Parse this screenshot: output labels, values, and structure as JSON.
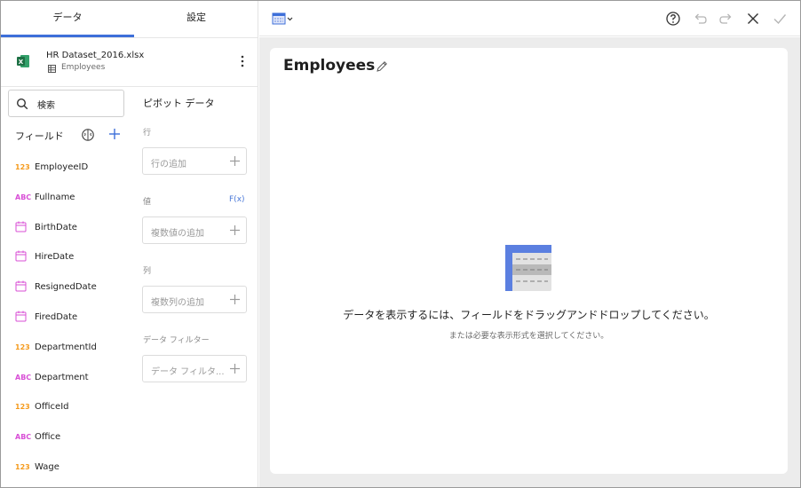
{
  "tabs": {
    "data": "データ",
    "settings": "設定"
  },
  "datasource": {
    "file": "HR Dataset_2016.xlsx",
    "sheet": "Employees"
  },
  "search": {
    "label": "検索"
  },
  "fields_title": "フィールド",
  "fields": [
    {
      "type": "123",
      "name": "EmployeeID"
    },
    {
      "type": "ABC",
      "name": "Fullname"
    },
    {
      "type": "date",
      "name": "BirthDate"
    },
    {
      "type": "date",
      "name": "HireDate"
    },
    {
      "type": "date",
      "name": "ResignedDate"
    },
    {
      "type": "date",
      "name": "FiredDate"
    },
    {
      "type": "123",
      "name": "DepartmentId"
    },
    {
      "type": "ABC",
      "name": "Department"
    },
    {
      "type": "123",
      "name": "OfficeId"
    },
    {
      "type": "ABC",
      "name": "Office"
    },
    {
      "type": "123",
      "name": "Wage"
    }
  ],
  "pivot": {
    "title": "ピボット データ",
    "rows_label": "行",
    "rows_placeholder": "行の追加",
    "values_label": "値",
    "fx": "F(x)",
    "values_placeholder": "複数値の追加",
    "columns_label": "列",
    "columns_placeholder": "複数列の追加",
    "filter_label": "データ フィルター",
    "filter_placeholder": "データ フィルタ..."
  },
  "main": {
    "title": "Employees",
    "empty_message": "データを表示するには、フィールドをドラッグアンドドロップしてください。",
    "empty_sub": "または必要な表示形式を選択してください。"
  },
  "colors": {
    "accent": "#3d6fd9",
    "number_type": "#f59a1c",
    "text_type": "#d84fd6",
    "excel_green": "#1e7145"
  }
}
